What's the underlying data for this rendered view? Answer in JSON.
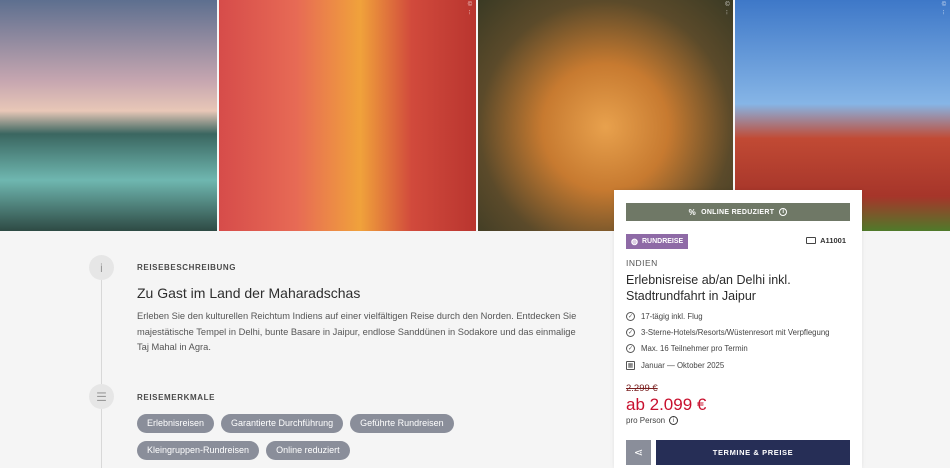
{
  "hero": {
    "images": [
      {
        "name": "taj-mahal-photo",
        "credit": ""
      },
      {
        "name": "sadhu-photo",
        "credit": "© ..."
      },
      {
        "name": "tiger-photo",
        "credit": "© ..."
      },
      {
        "name": "red-fort-photo",
        "credit": "© ..."
      }
    ]
  },
  "description": {
    "label": "REISEBESCHREIBUNG",
    "title": "Zu Gast im Land der Maharadschas",
    "text": "Erleben Sie den kulturellen Reichtum Indiens auf einer vielfältigen Reise durch den Norden. Entdecken Sie majestätische Tempel in Delhi, bunte Basare in Jaipur, endlose Sanddünen in Sodakore und das einmalige Taj Mahal in Agra."
  },
  "features_section": {
    "label": "REISEMERKMALE",
    "tags": [
      "Erlebnisreisen",
      "Garantierte Durchführung",
      "Geführte Rundreisen",
      "Kleingruppen-Rundreisen",
      "Online reduziert"
    ]
  },
  "card": {
    "online_label": "ONLINE REDUZIERT",
    "type_badge": "RUNDREISE",
    "code": "A11001",
    "country": "INDIEN",
    "title": "Erlebnisreise ab/an Delhi inkl. Stadtrundfahrt in Jaipur",
    "features": [
      {
        "icon": "check-circle-icon",
        "text": "17-tägig inkl. Flug"
      },
      {
        "icon": "check-circle-icon",
        "text": "3-Sterne-Hotels/Resorts/Wüstenresort mit Verpflegung"
      },
      {
        "icon": "check-circle-icon",
        "text": "Max. 16 Teilnehmer pro Termin"
      },
      {
        "icon": "calendar-icon",
        "text": "Januar — Oktober 2025"
      }
    ],
    "old_price": "2.299 €",
    "new_price": "ab 2.099 €",
    "per_person": "pro Person",
    "cta_label": "TERMINE & PREISE"
  },
  "colors": {
    "online_bar": "#6f7866",
    "badge": "#8e6aa6",
    "price": "#c8102e",
    "cta": "#262e56",
    "tag": "#8a8e9a"
  }
}
